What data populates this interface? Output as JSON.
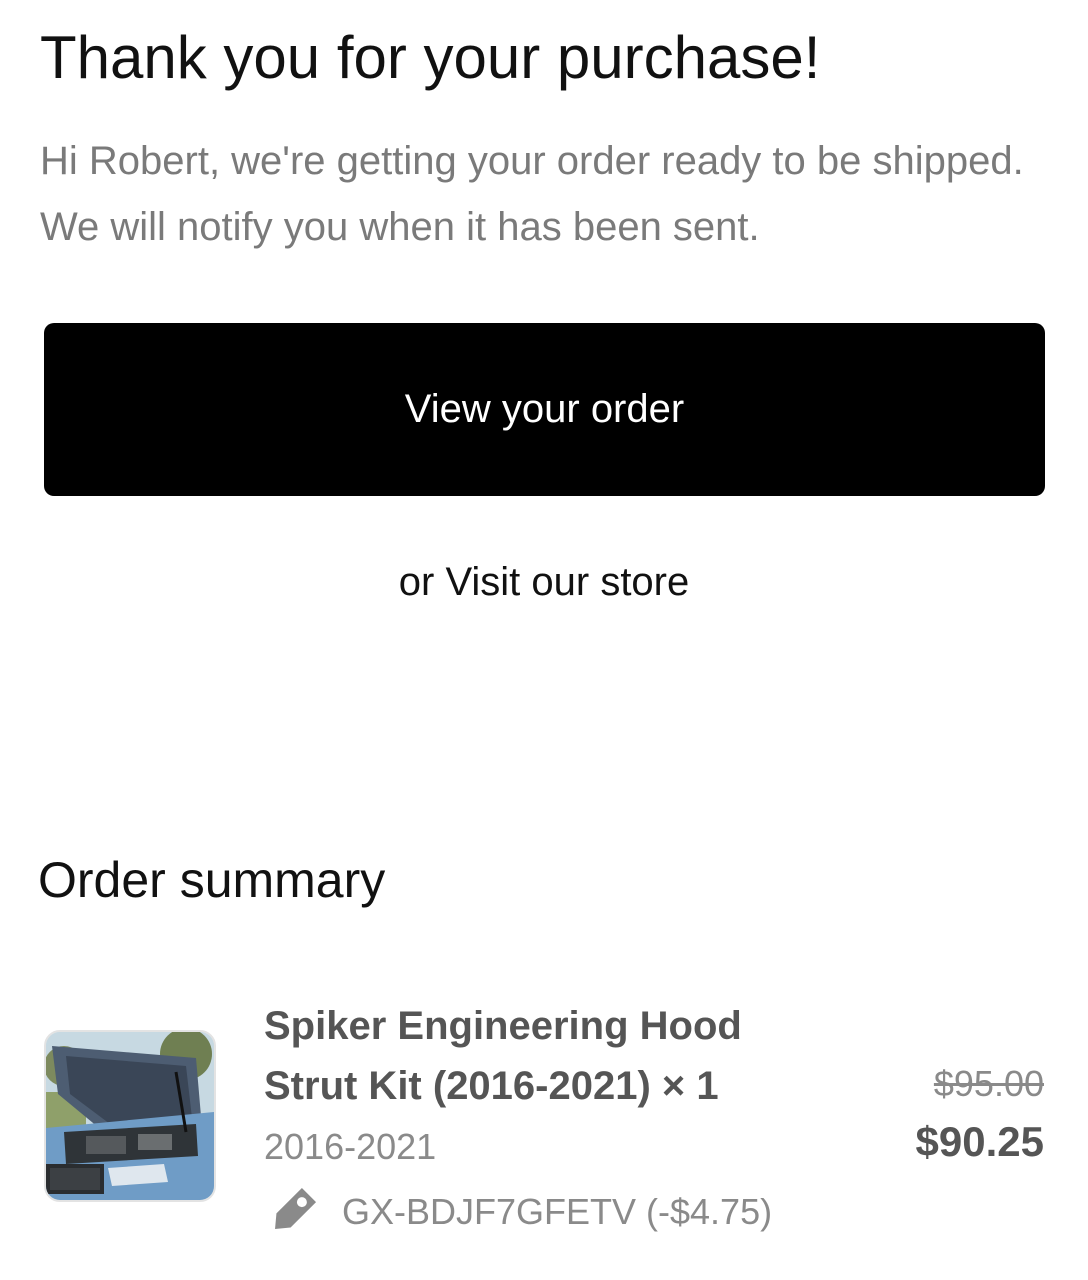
{
  "header": {
    "title": "Thank you for your purchase!",
    "intro": "Hi Robert, we're getting your order ready to be shipped. We will notify you when it has been sent."
  },
  "actions": {
    "view_order_label": "View your order",
    "visit_prefix": "or",
    "visit_store_label": "Visit our store"
  },
  "order_summary": {
    "heading": "Order summary",
    "items": [
      {
        "name": "Spiker Engineering Hood Strut Kit (2016-2021) × 1",
        "variant": "2016-2021",
        "original_price": "$95.00",
        "price": "$90.25",
        "discount_code": "GX-BDJF7GFETV (-$4.75)",
        "image_icon": "truck-hood-open-photo",
        "discount_icon": "tag-icon"
      }
    ]
  },
  "colors": {
    "button_bg": "#000000",
    "muted_text": "#7a7a7a",
    "product_text": "#555555"
  }
}
